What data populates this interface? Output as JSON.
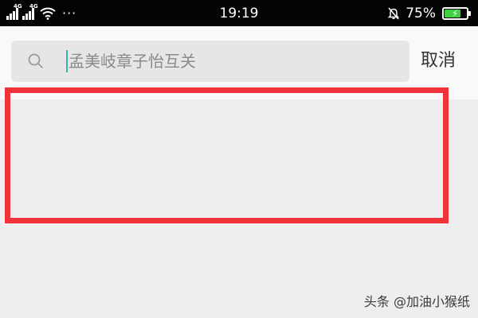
{
  "status_bar": {
    "signal_1_label": "4G",
    "signal_2_label": "4G",
    "overflow": "···",
    "time": "19:19",
    "battery_percent": "75%",
    "battery_level": 0.75,
    "charging_color": "#3bd13f"
  },
  "search": {
    "query": "孟美岐章子怡互关",
    "cancel_label": "取消",
    "caret_color": "#36b6a6"
  },
  "highlight": {
    "color": "#f0323a"
  },
  "watermark": {
    "text": "头条 @加油小猴纸"
  }
}
